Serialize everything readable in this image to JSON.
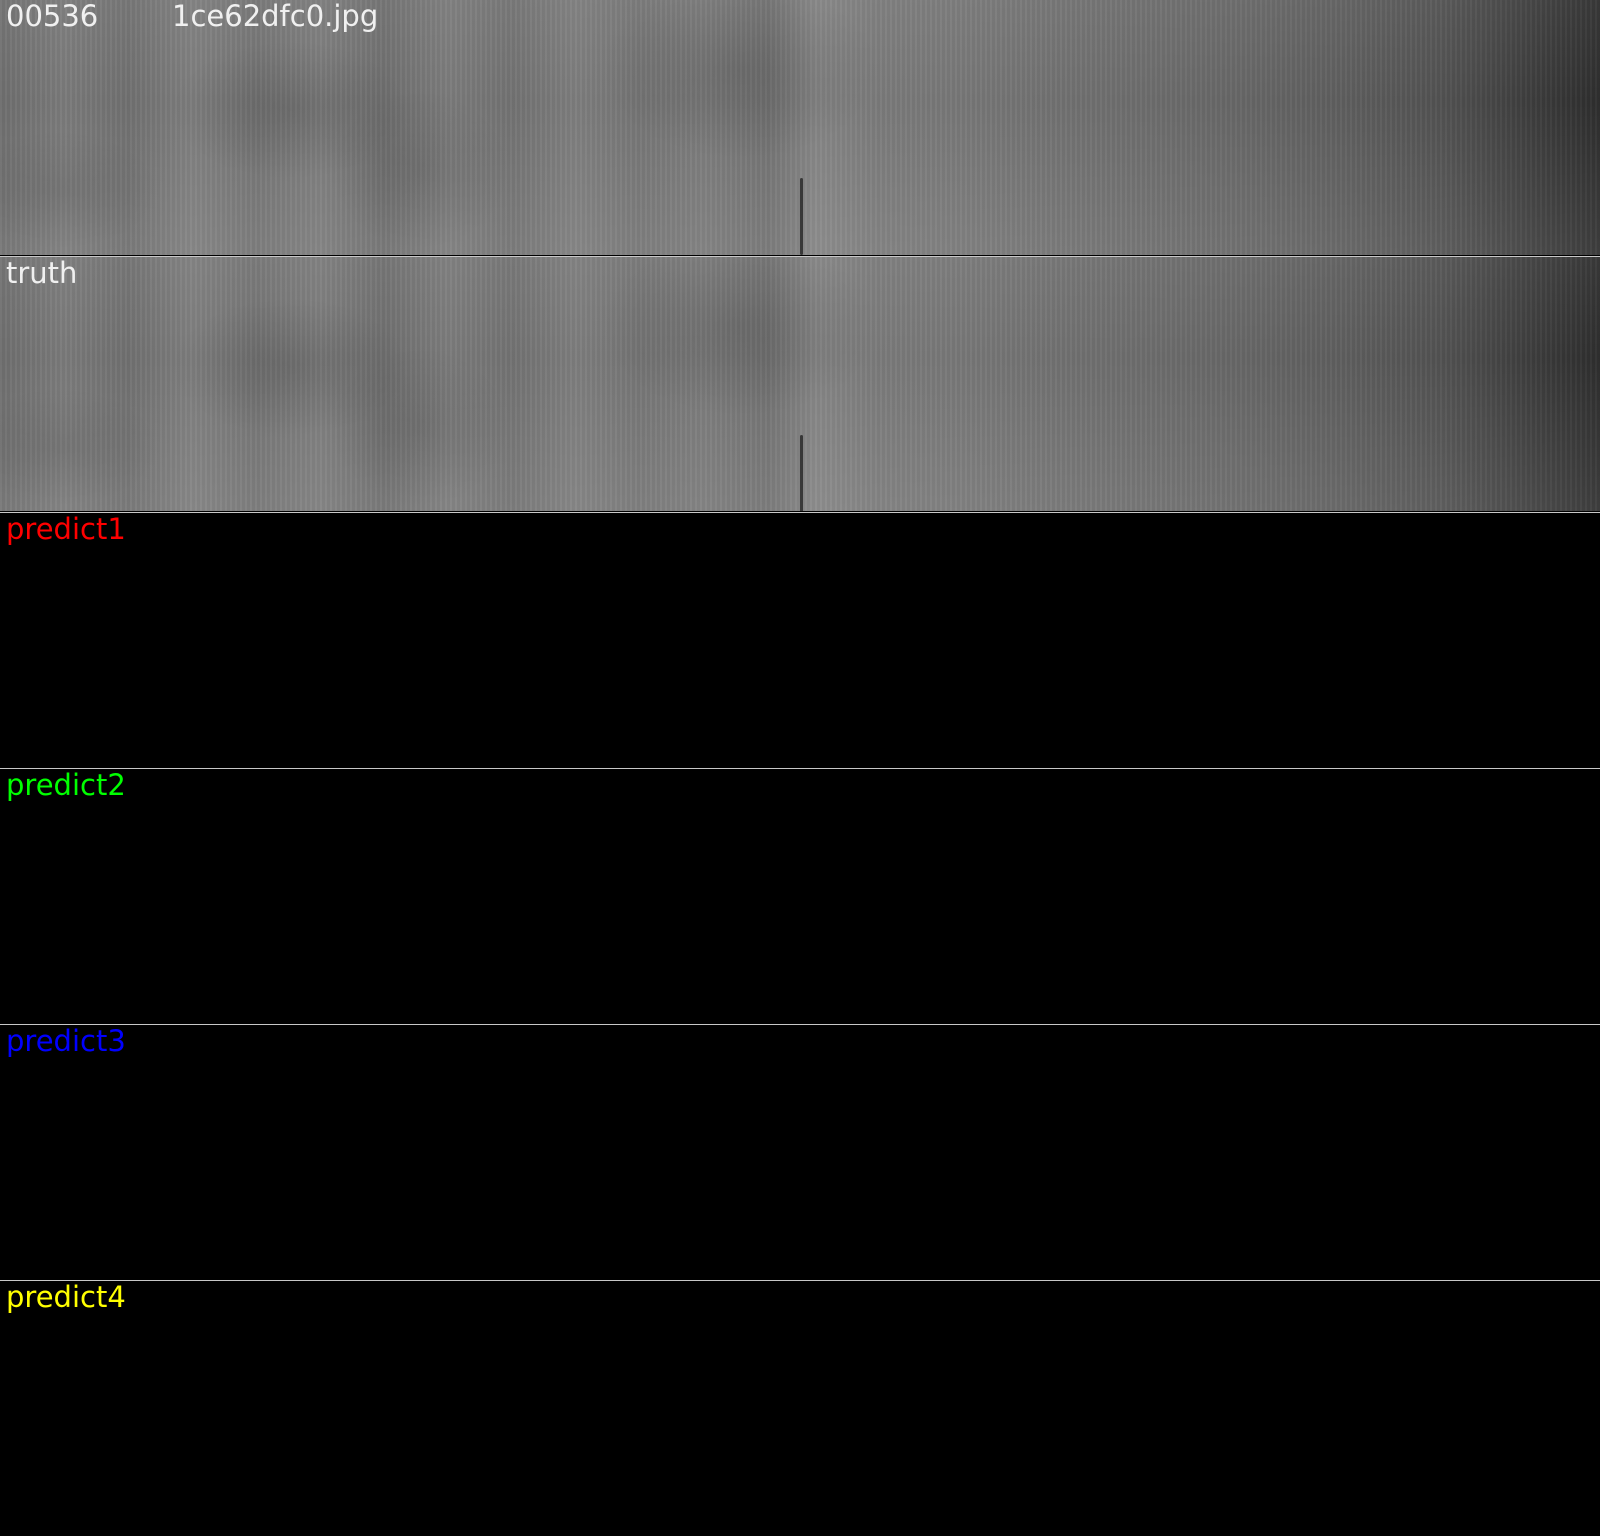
{
  "header": {
    "index": "00536",
    "filename": "1ce62dfc0.jpg"
  },
  "panels": [
    {
      "label": "truth",
      "color": "#f0f0f0"
    },
    {
      "label": "predict1",
      "color": "#ff0000"
    },
    {
      "label": "predict2",
      "color": "#00ff00"
    },
    {
      "label": "predict3",
      "color": "#0000ff"
    },
    {
      "label": "predict4",
      "color": "#ffff00"
    }
  ]
}
